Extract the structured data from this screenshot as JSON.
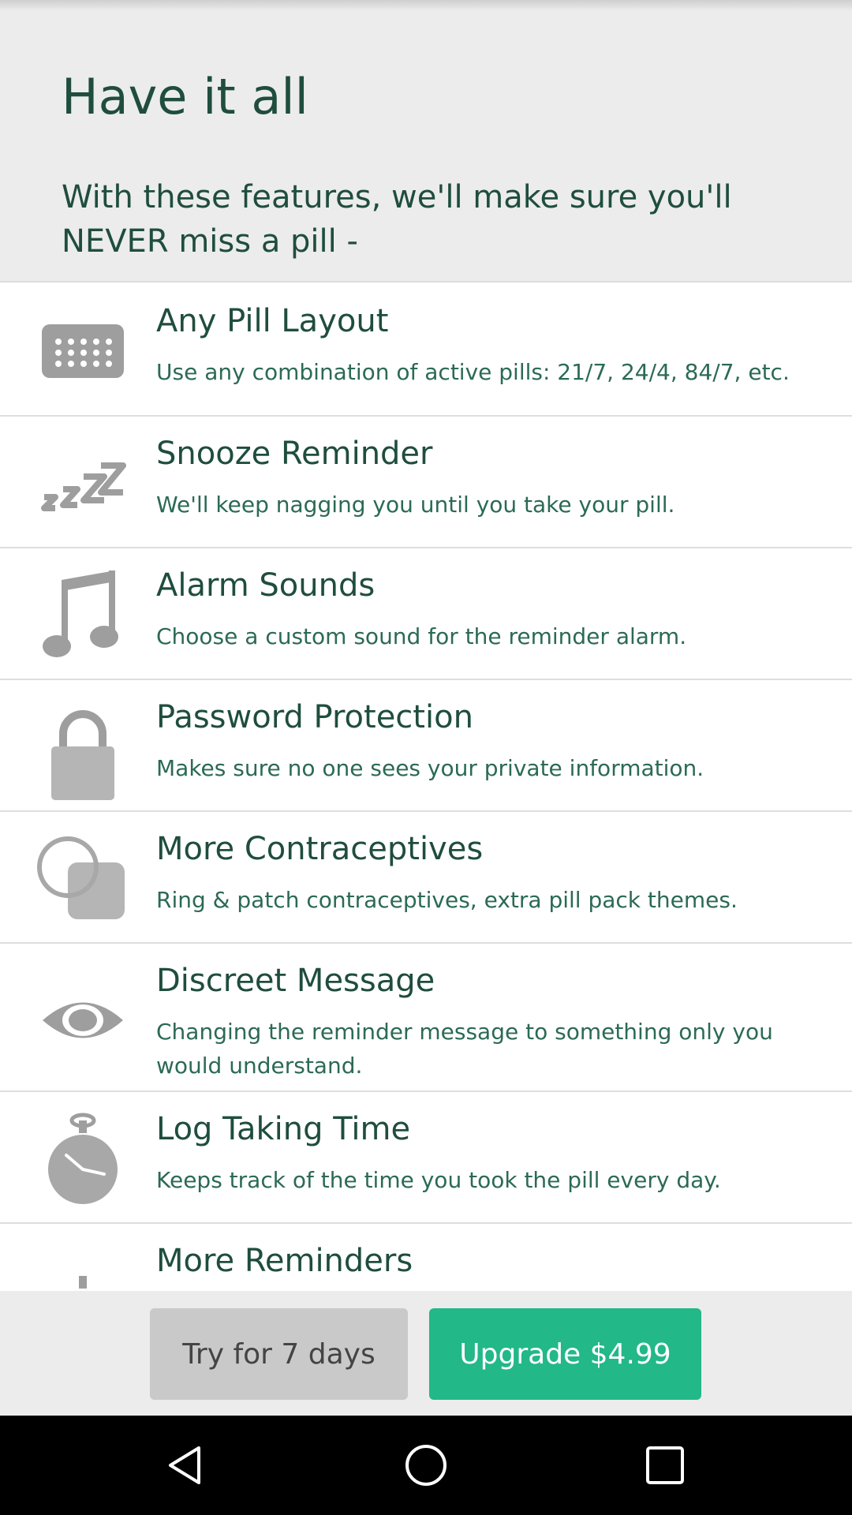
{
  "header": {
    "title": "Have it all",
    "subtitle": "With these features, we'll make sure you'll NEVER miss a pill -"
  },
  "features": [
    {
      "title": "Any Pill Layout",
      "description": "Use any combination of active pills: 21/7, 24/4, 84/7, etc.",
      "icon": "calendar-grid-icon"
    },
    {
      "title": "Snooze Reminder",
      "description": "We'll keep nagging you until you take your pill.",
      "icon": "zzz-icon"
    },
    {
      "title": "Alarm Sounds",
      "description": "Choose a custom sound for the reminder alarm.",
      "icon": "music-note-icon"
    },
    {
      "title": "Password Protection",
      "description": "Makes sure no one sees your private information.",
      "icon": "lock-icon"
    },
    {
      "title": "More Contraceptives",
      "description": "Ring & patch contraceptives, extra pill pack themes.",
      "icon": "ring-patch-icon"
    },
    {
      "title": "Discreet Message",
      "description": "Changing the reminder message to something only you would understand.",
      "icon": "eye-icon"
    },
    {
      "title": "Log Taking Time",
      "description": "Keeps track of the time you took the pill every day.",
      "icon": "stopwatch-icon"
    },
    {
      "title": "More Reminders",
      "description": "",
      "icon": "alarm-clock-icon"
    }
  ],
  "buttons": {
    "try_label": "Try for 7 days",
    "upgrade_label": "Upgrade $4.99"
  },
  "colors": {
    "accent": "#22b888",
    "title_text": "#1f4d3e",
    "icon_gray": "#9e9e9e"
  },
  "navbar": {
    "icons": [
      "back-icon",
      "home-icon",
      "recents-icon"
    ]
  }
}
